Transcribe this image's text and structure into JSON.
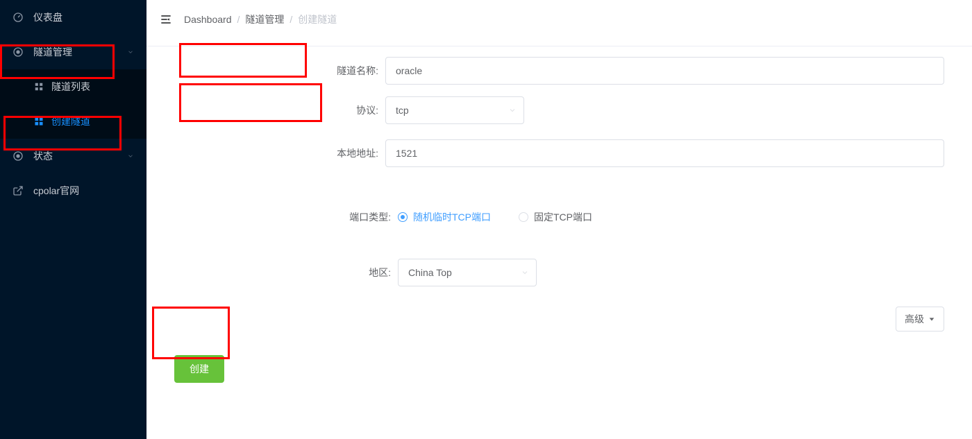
{
  "sidebar": {
    "dashboard": {
      "label": "仪表盘"
    },
    "tunnel": {
      "label": "隧道管理"
    },
    "tunnel_list": {
      "label": "隧道列表"
    },
    "tunnel_create": {
      "label": "创建隧道"
    },
    "status": {
      "label": "状态"
    },
    "cpolar": {
      "label": "cpolar官网"
    }
  },
  "breadcrumb": {
    "a": "Dashboard",
    "b": "隧道管理",
    "c": "创建隧道"
  },
  "form": {
    "tunnel_name": {
      "label": "隧道名称:",
      "value": "oracle"
    },
    "protocol": {
      "label": "协议:",
      "value": "tcp"
    },
    "local_addr": {
      "label": "本地地址:",
      "value": "1521"
    },
    "port_type": {
      "label": "端口类型:",
      "random": "随机临时TCP端口",
      "fixed": "固定TCP端口",
      "selected": "random"
    },
    "region": {
      "label": "地区:",
      "value": "China Top"
    },
    "advanced": {
      "label": "高级"
    },
    "create_btn": {
      "label": "创建"
    }
  },
  "colors": {
    "accent_blue": "#409eff",
    "green": "#67c23a",
    "sidebar_bg": "#001529",
    "red_highlight": "#ff0000"
  }
}
